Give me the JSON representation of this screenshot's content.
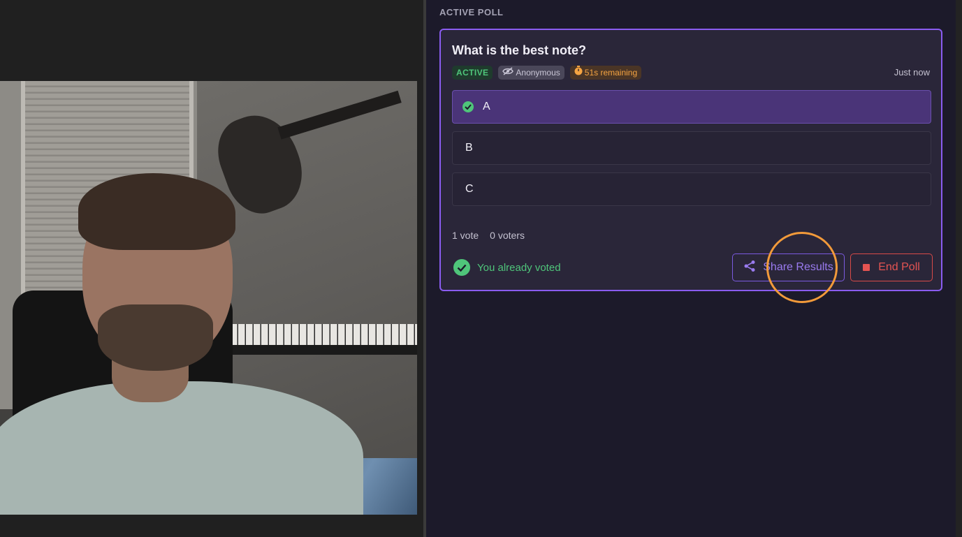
{
  "poll_panel": {
    "section_title": "ACTIVE POLL",
    "poll": {
      "question": "What is the best note?",
      "badges": {
        "status": "ACTIVE",
        "privacy": "Anonymous",
        "timer": "51s remaining"
      },
      "timestamp": "Just now",
      "options": [
        {
          "label": "A",
          "selected": true
        },
        {
          "label": "B",
          "selected": false
        },
        {
          "label": "C",
          "selected": false
        }
      ],
      "stats": {
        "votes": "1 vote",
        "voters": "0 voters"
      },
      "voted_message": "You already voted",
      "actions": {
        "share_label": "Share Results",
        "end_label": "End Poll"
      }
    }
  },
  "colors": {
    "accent": "#8a5cf0",
    "success": "#4fc57a",
    "danger": "#e55452",
    "warning": "#f5a442",
    "cursor_highlight": "#f29a3a"
  },
  "icons": {
    "privacy": "eye-off-icon",
    "timer": "stopwatch-icon",
    "selected_option": "check-circle-icon",
    "voted": "check-circle-icon",
    "share": "share-icon",
    "end": "stop-icon"
  }
}
